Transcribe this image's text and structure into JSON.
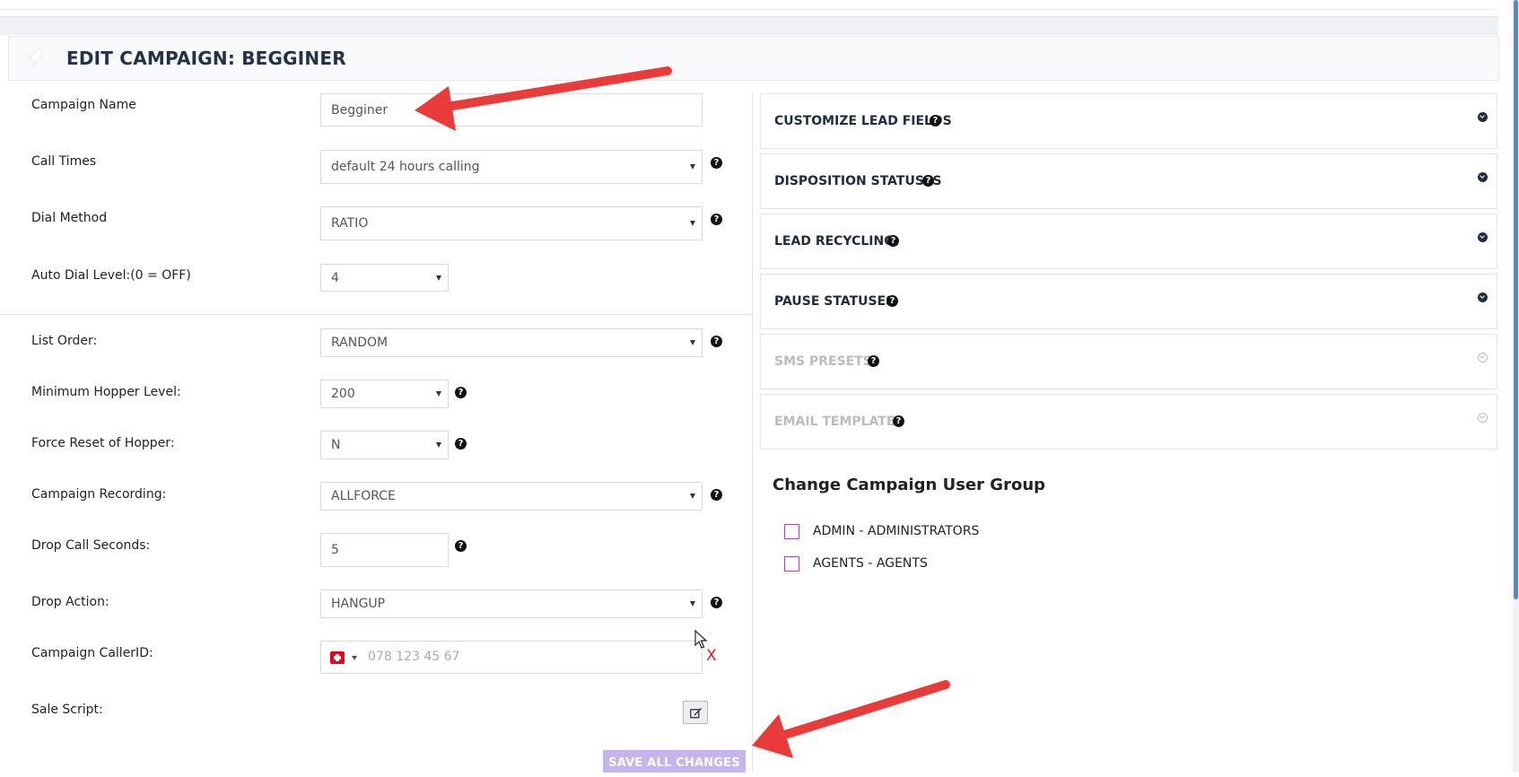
{
  "header": {
    "title": "EDIT CAMPAIGN: BEGGINER"
  },
  "form": {
    "campaign_name_label": "Campaign Name",
    "campaign_name_value": "Begginer",
    "call_times_label": "Call Times",
    "call_times_value": "default 24 hours calling",
    "dial_method_label": "Dial Method",
    "dial_method_value": "RATIO",
    "auto_dial_label": "Auto Dial Level:(0 = OFF)",
    "auto_dial_value": "4",
    "list_order_label": "List Order:",
    "list_order_value": "RANDOM",
    "min_hopper_label": "Minimum Hopper Level:",
    "min_hopper_value": "200",
    "force_reset_label": "Force Reset of Hopper:",
    "force_reset_value": "N",
    "recording_label": "Campaign Recording:",
    "recording_value": "ALLFORCE",
    "drop_seconds_label": "Drop Call Seconds:",
    "drop_seconds_value": "5",
    "drop_action_label": "Drop Action:",
    "drop_action_value": "HANGUP",
    "callerid_label": "Campaign CallerID:",
    "callerid_placeholder": "078 123 45 67",
    "callerid_clear": "X",
    "sale_script_label": "Sale Script:",
    "save_button": "SAVE ALL CHANGES"
  },
  "help_glyph": "?",
  "panels": [
    {
      "title": "CUSTOMIZE LEAD FIELDS",
      "enabled": true
    },
    {
      "title": "DISPOSITION STATUSES",
      "enabled": true
    },
    {
      "title": "LEAD RECYCLING",
      "enabled": true
    },
    {
      "title": "PAUSE STATUSES",
      "enabled": true
    },
    {
      "title": "SMS PRESETS",
      "enabled": false
    },
    {
      "title": "EMAIL TEMPLATES",
      "enabled": false
    }
  ],
  "user_group": {
    "title": "Change Campaign User Group",
    "options": [
      {
        "label": "ADMIN - ADMINISTRATORS",
        "checked": false
      },
      {
        "label": "AGENTS - AGENTS",
        "checked": false
      }
    ]
  },
  "colors": {
    "header_title": "#233345",
    "save_button_bg": "#c6b4ec",
    "annotation_arrow": "#ea3b3b",
    "checkbox_border": "#9a4fb3",
    "clear_x": "#e0191e"
  },
  "icons": {
    "header": "rocket-icon",
    "help": "question-circle-icon",
    "panel_toggle": "chevron-down-circle-icon",
    "sale_script_edit": "edit-icon",
    "callerid_country": "swiss-flag-icon"
  }
}
